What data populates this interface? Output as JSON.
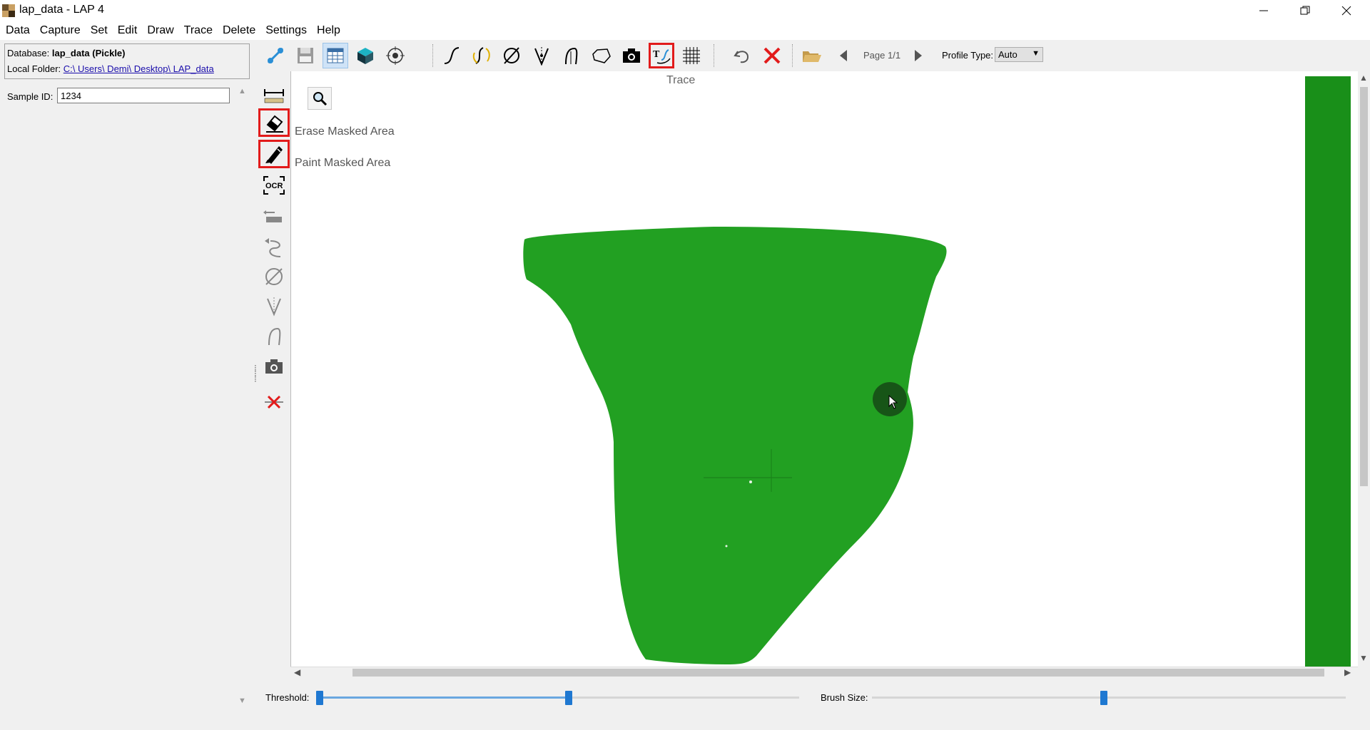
{
  "window": {
    "title": "lap_data - LAP 4",
    "controls": [
      "minimize",
      "restore",
      "close"
    ]
  },
  "menu": [
    "Data",
    "Capture",
    "Set",
    "Edit",
    "Draw",
    "Trace",
    "Delete",
    "Settings",
    "Help"
  ],
  "left_panel": {
    "database_label": "Database:",
    "database_value": "lap_data (Pickle)",
    "folder_label": "Local Folder:",
    "folder_value": "C:\\ Users\\ Demi\\ Desktop\\ LAP_data",
    "sample_id_label": "Sample ID:",
    "sample_id_value": "1234"
  },
  "toolbar": {
    "buttons": [
      {
        "name": "connect-icon",
        "selected": false
      },
      {
        "name": "save-icon",
        "selected": false
      },
      {
        "name": "table-view-icon",
        "selected": true
      },
      {
        "name": "3d-box-icon",
        "selected": false
      },
      {
        "name": "target-icon",
        "selected": false
      },
      {
        "name": "curve-icon",
        "selected": false
      },
      {
        "name": "curve-transform-icon",
        "selected": false
      },
      {
        "name": "diameter-icon",
        "selected": false
      },
      {
        "name": "split-trace-icon",
        "selected": false
      },
      {
        "name": "pen-trace-icon",
        "selected": false
      },
      {
        "name": "polygon-icon",
        "selected": false
      },
      {
        "name": "camera-icon",
        "selected": false
      },
      {
        "name": "text-trace-icon",
        "selected": false,
        "highlighted": true
      },
      {
        "name": "grid-icon",
        "selected": false
      },
      {
        "name": "undo-icon",
        "selected": false
      },
      {
        "name": "delete-x-icon",
        "selected": false
      },
      {
        "name": "open-folder-icon",
        "selected": false
      },
      {
        "name": "prev-page-icon",
        "selected": false
      },
      {
        "name": "next-page-icon",
        "selected": false
      }
    ],
    "page_label": "Page 1/1",
    "profile_type_label": "Profile Type:",
    "profile_type_value": "Auto",
    "tooltip": "Trace"
  },
  "vertical_toolbar": {
    "buttons": [
      "measure-icon",
      "eraser-icon",
      "pencil-icon",
      "ocr-icon",
      "align-icon",
      "curve-back-icon",
      "diameter-back-icon",
      "split-back-icon",
      "pen-back-icon",
      "camera-icon",
      "delete-all-icon"
    ],
    "highlighted": [
      "eraser-icon",
      "pencil-icon"
    ],
    "erase_label": "Erase Masked Area",
    "paint_label": "Paint Masked Area"
  },
  "canvas": {
    "mask_color": "#22a022",
    "strip_color": "#198f19"
  },
  "sliders": {
    "threshold_label": "Threshold:",
    "threshold_value": 0.52,
    "brush_size_label": "Brush Size:",
    "brush_size_value": 0.49
  }
}
